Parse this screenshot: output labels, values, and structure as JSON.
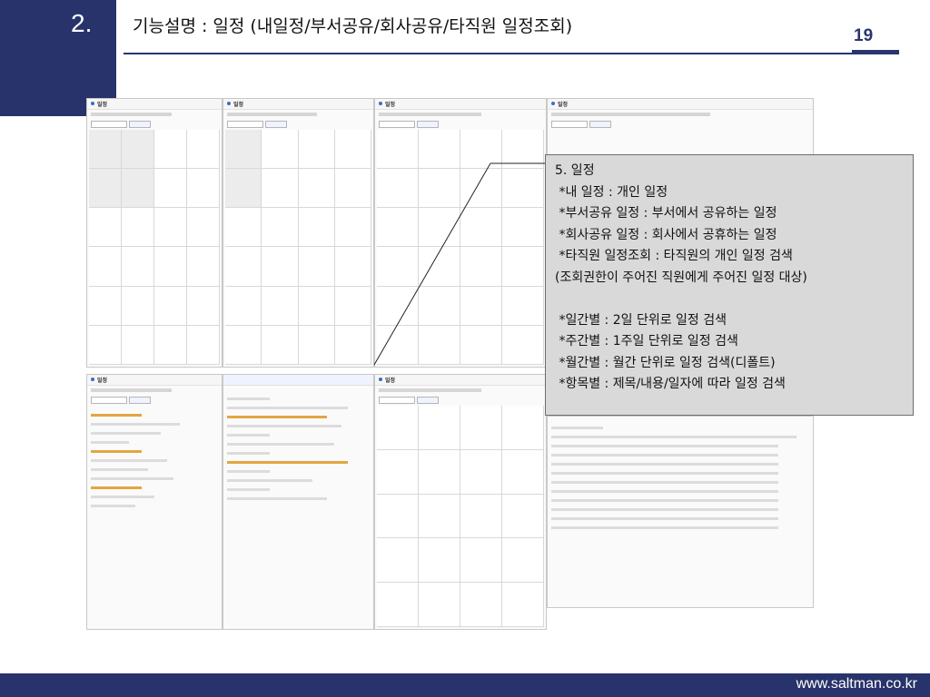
{
  "section_number": "2.",
  "title": "기능설명 : 일정 (내일정/부서공유/회사공유/타직원 일정조회)",
  "page_number": "19",
  "footer_url": "www.saltman.co.kr",
  "screenshot_label": "일정",
  "note": {
    "lines": [
      "5. 일정",
      " *내 일정 : 개인 일정",
      " *부서공유 일정 : 부서에서 공유하는 일정",
      " *회사공유 일정 : 회사에서 공휴하는 일정",
      " *타직원 일정조회 : 타직원의 개인 일정 검색",
      "(조회권한이 주어진 직원에게 주어진 일정 대상)",
      "",
      " *일간별 : 2일 단위로 일정 검색",
      " *주간별 : 1주일 단위로 일정 검색",
      " *월간별 : 월간 단위로 일정 검색(디폴트)",
      " *항목별 : 제목/내용/일자에 따라 일정 검색"
    ]
  },
  "colors": {
    "navy": "#28336b",
    "note_bg": "#d9d9d9",
    "screenshot_accent": "#3a6ec2"
  }
}
